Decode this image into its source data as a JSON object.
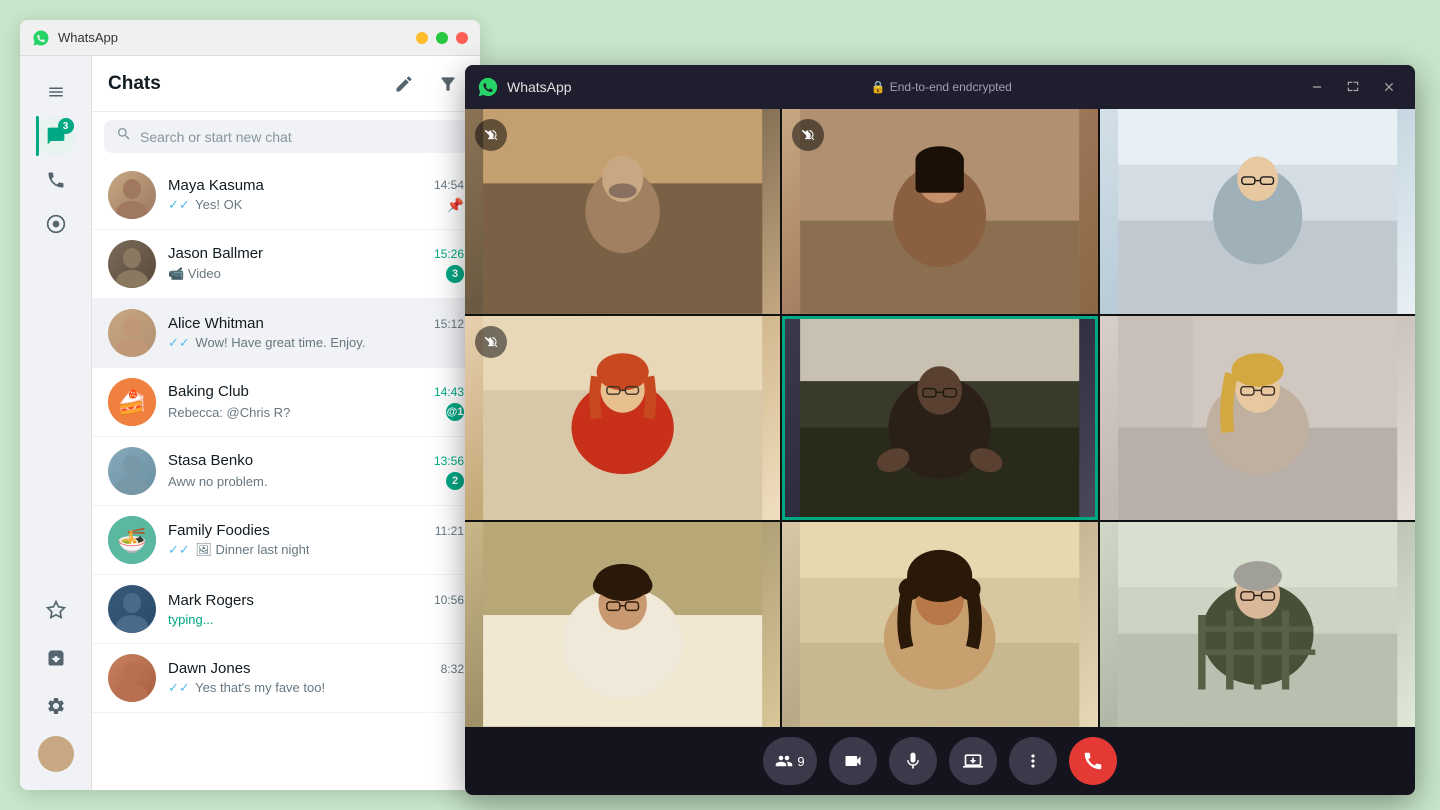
{
  "app": {
    "title": "WhatsApp",
    "call_title": "WhatsApp",
    "e2e_label": "End-to-end endcrypted",
    "lock_icon": "🔒"
  },
  "sidebar": {
    "badge_count": "3",
    "icons": [
      {
        "name": "menu-icon",
        "symbol": "☰",
        "active": false
      },
      {
        "name": "chats-icon",
        "symbol": "💬",
        "active": true
      },
      {
        "name": "calls-icon",
        "symbol": "📞",
        "active": false
      },
      {
        "name": "status-icon",
        "symbol": "⬤",
        "active": false
      },
      {
        "name": "starred-icon",
        "symbol": "☆",
        "active": false
      },
      {
        "name": "archived-icon",
        "symbol": "🗄",
        "active": false
      },
      {
        "name": "settings-icon",
        "symbol": "⚙",
        "active": false
      }
    ]
  },
  "chats": {
    "title": "Chats",
    "new_chat_tooltip": "New chat",
    "filter_tooltip": "Filter",
    "search_placeholder": "Search or start new chat",
    "items": [
      {
        "id": 1,
        "name": "Maya Kasuma",
        "message": "Yes! OK",
        "time": "14:54",
        "unread": 0,
        "pinned": true,
        "read": true,
        "avatar_bg": "#a0785a"
      },
      {
        "id": 2,
        "name": "Jason Ballmer",
        "message": "📹 Video",
        "time": "15:26",
        "unread": 3,
        "pinned": false,
        "read": false,
        "avatar_bg": "#7a6a5a"
      },
      {
        "id": 3,
        "name": "Alice Whitman",
        "message": "Wow! Have great time. Enjoy.",
        "time": "15:12",
        "unread": 0,
        "active": true,
        "read": true,
        "avatar_bg": "#c8a882"
      },
      {
        "id": 4,
        "name": "Baking Club",
        "message": "Rebecca: @Chris R?",
        "time": "14:43",
        "unread": 1,
        "mention": true,
        "avatar_bg": "#e8784a"
      },
      {
        "id": 5,
        "name": "Stasa Benko",
        "message": "Aww no problem.",
        "time": "13:56",
        "unread": 2,
        "avatar_bg": "#88aabb"
      },
      {
        "id": 6,
        "name": "Family Foodies",
        "message": "Dinner last night",
        "time": "11:21",
        "unread": 0,
        "read": true,
        "has_image": true,
        "avatar_bg": "#5ab8a0"
      },
      {
        "id": 7,
        "name": "Mark Rogers",
        "message": "typing...",
        "typing": true,
        "time": "10:56",
        "unread": 0,
        "avatar_bg": "#3a5a7a"
      },
      {
        "id": 8,
        "name": "Dawn Jones",
        "message": "Yes that's my fave too!",
        "time": "8:32",
        "unread": 0,
        "read": true,
        "avatar_bg": "#c88060"
      }
    ]
  },
  "call": {
    "participants_count": "9",
    "controls": [
      {
        "name": "participants-btn",
        "symbol": "👥",
        "label": "9"
      },
      {
        "name": "video-btn",
        "symbol": "📹"
      },
      {
        "name": "mute-btn",
        "symbol": "🎤"
      },
      {
        "name": "screen-share-btn",
        "symbol": "⬆"
      },
      {
        "name": "more-btn",
        "symbol": "•••"
      },
      {
        "name": "end-call-btn",
        "symbol": "📵"
      }
    ],
    "participants": [
      {
        "id": 1,
        "muted": true,
        "highlighted": false,
        "bg": "vid1"
      },
      {
        "id": 2,
        "muted": true,
        "highlighted": false,
        "bg": "vid2"
      },
      {
        "id": 3,
        "muted": false,
        "highlighted": false,
        "bg": "vid3"
      },
      {
        "id": 4,
        "muted": true,
        "highlighted": false,
        "bg": "vid4"
      },
      {
        "id": 5,
        "muted": false,
        "highlighted": true,
        "bg": "vid5"
      },
      {
        "id": 6,
        "muted": false,
        "highlighted": false,
        "bg": "vid6"
      },
      {
        "id": 7,
        "muted": false,
        "highlighted": false,
        "bg": "vid7"
      },
      {
        "id": 8,
        "muted": false,
        "highlighted": false,
        "bg": "vid8"
      },
      {
        "id": 9,
        "muted": false,
        "highlighted": false,
        "bg": "vid9"
      }
    ]
  },
  "window_controls": {
    "minimize": "—",
    "maximize": "□",
    "close": "✕"
  }
}
